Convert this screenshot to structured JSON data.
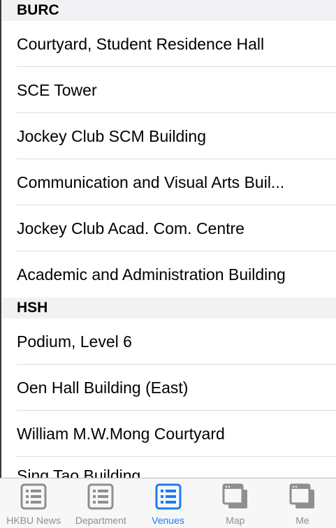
{
  "sections": [
    {
      "title": "BURC",
      "items": [
        "Courtyard, Student Residence Hall",
        "SCE Tower",
        "Jockey Club SCM Building",
        "Communication and Visual Arts Buil...",
        "Jockey Club Acad. Com. Centre",
        "Academic and Administration Building"
      ]
    },
    {
      "title": "HSH",
      "items": [
        "Podium, Level 6",
        "Oen Hall Building (East)",
        "William M.W.Mong Courtyard",
        "Sing Tao Building"
      ]
    }
  ],
  "tabbar": {
    "tabs": [
      {
        "label": "HKBU News",
        "icon": "list-icon",
        "active": false
      },
      {
        "label": "Department",
        "icon": "list-icon",
        "active": false
      },
      {
        "label": "Venues",
        "icon": "list-icon",
        "active": true
      },
      {
        "label": "Map",
        "icon": "windows-icon",
        "active": false
      },
      {
        "label": "Me",
        "icon": "windows-icon",
        "active": false
      }
    ]
  },
  "colors": {
    "accent": "#1a7cf5",
    "inactive": "#8e8e93"
  }
}
